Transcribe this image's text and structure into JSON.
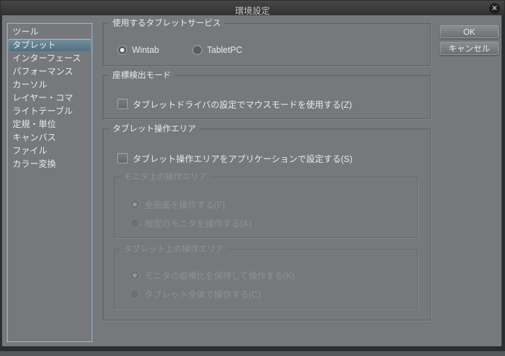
{
  "window": {
    "title": "環境設定",
    "close_glyph": "✕"
  },
  "sidebar": {
    "items": [
      {
        "label": "ツール",
        "selected": false
      },
      {
        "label": "タブレット",
        "selected": true
      },
      {
        "label": "インターフェース",
        "selected": false
      },
      {
        "label": "パフォーマンス",
        "selected": false
      },
      {
        "label": "カーソル",
        "selected": false
      },
      {
        "label": "レイヤー・コマ",
        "selected": false
      },
      {
        "label": "ライトテーブル",
        "selected": false
      },
      {
        "label": "定規・単位",
        "selected": false
      },
      {
        "label": "キャンバス",
        "selected": false
      },
      {
        "label": "ファイル",
        "selected": false
      },
      {
        "label": "カラー変換",
        "selected": false
      }
    ]
  },
  "groups": {
    "tablet_service": {
      "legend": "使用するタブレットサービス",
      "options": [
        {
          "label": "Wintab",
          "selected": true
        },
        {
          "label": "TabletPC",
          "selected": false
        }
      ]
    },
    "coordinate_mode": {
      "legend": "座標検出モード",
      "checkbox": {
        "label": "タブレットドライバの設定でマウスモードを使用する(Z)",
        "checked": false
      }
    },
    "tablet_area": {
      "legend": "タブレット操作エリア",
      "checkbox": {
        "label": "タブレット操作エリアをアプリケーションで設定する(S)",
        "checked": false
      },
      "monitor_area": {
        "legend": "モニタ上の操作エリア",
        "disabled": true,
        "options": [
          {
            "label": "全画面を操作する(F)",
            "selected": true
          },
          {
            "label": "指定のモニタを操作する(A)",
            "selected": false
          }
        ]
      },
      "tablet_surface_area": {
        "legend": "タブレット上の操作エリア",
        "disabled": true,
        "options": [
          {
            "label": "モニタの縦横比を保持して操作する(K)",
            "selected": true
          },
          {
            "label": "タブレット全体で操作する(C)",
            "selected": false
          }
        ]
      }
    }
  },
  "buttons": {
    "ok": "OK",
    "cancel": "キャンセル"
  },
  "colors": {
    "dialog_background": "#77787b",
    "titlebar_background": "#373737",
    "selection_background": "#5d7a8c",
    "list_border": "#8cc3de",
    "enabled_text": "#e9eaeb",
    "disabled_text": "#8f9193"
  }
}
